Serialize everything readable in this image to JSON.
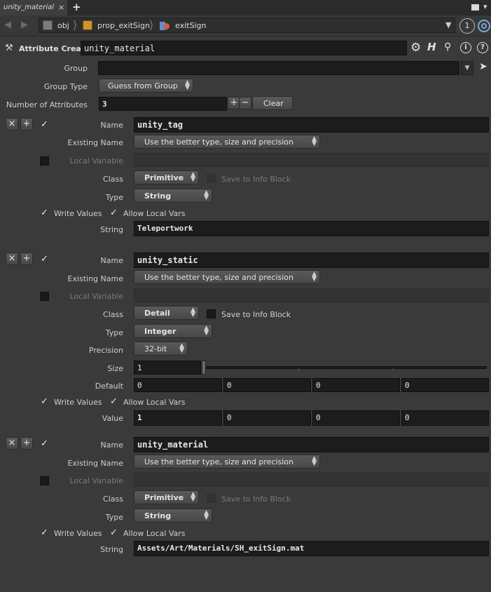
{
  "tab": {
    "title": "unity_material",
    "close": "×",
    "add": "+"
  },
  "window": {
    "menu_icon": "▀",
    "dropdown": "▾"
  },
  "path": {
    "crumbs": [
      "obj",
      "prop_exitSign",
      "exitSign"
    ],
    "pin_number": "1"
  },
  "node": {
    "type_label": "Attribute Create",
    "name": "unity_material"
  },
  "group": {
    "label": "Group",
    "value": ""
  },
  "group_type": {
    "label": "Group Type",
    "value": "Guess from Group"
  },
  "num_attrs": {
    "label": "Number of Attributes",
    "value": "3",
    "plus": "+",
    "minus": "−",
    "clear": "Clear"
  },
  "labels": {
    "name": "Name",
    "existing_name": "Existing Name",
    "local_variable": "Local Variable",
    "class": "Class",
    "save_info": "Save to Info Block",
    "type": "Type",
    "write_values": "Write Values",
    "allow_local": "Allow Local Vars",
    "string": "String",
    "precision": "Precision",
    "size": "Size",
    "default": "Default",
    "value": "Value"
  },
  "attrs": [
    {
      "name": "unity_tag",
      "existing": "Use the better type, size and precision",
      "class": "Primitive",
      "type": "String",
      "string": "Teleportwork"
    },
    {
      "name": "unity_static",
      "existing": "Use the better type, size and precision",
      "class": "Detail",
      "type": "Integer",
      "precision": "32-bit",
      "size": "1",
      "size_fraction": 0.0,
      "default": [
        "0",
        "0",
        "0",
        "0"
      ],
      "value": [
        "1",
        "0",
        "0",
        "0"
      ]
    },
    {
      "name": "unity_material",
      "existing": "Use the better type, size and precision",
      "class": "Primitive",
      "type": "String",
      "string": "Assets/Art/Materials/SH_exitSign.mat"
    }
  ],
  "glyphs": {
    "remove": "×",
    "add": "+",
    "check": "✓"
  }
}
